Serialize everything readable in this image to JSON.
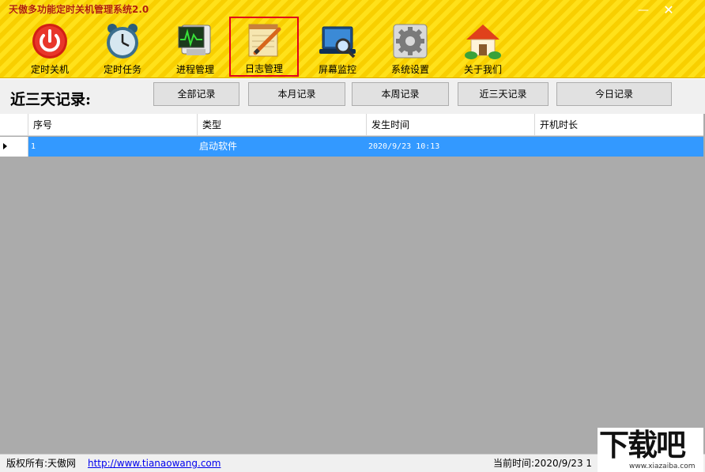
{
  "window": {
    "title": "天傲多功能定时关机管理系统2.0",
    "minimize": "—",
    "close": "✕"
  },
  "toolbar": {
    "items": [
      {
        "label": "定时关机",
        "icon": "power-icon"
      },
      {
        "label": "定时任务",
        "icon": "alarm-clock-icon"
      },
      {
        "label": "进程管理",
        "icon": "monitor-chart-icon"
      },
      {
        "label": "日志管理",
        "icon": "notepad-pen-icon",
        "active": true
      },
      {
        "label": "屏幕监控",
        "icon": "laptop-magnifier-icon"
      },
      {
        "label": "系统设置",
        "icon": "gear-icon"
      },
      {
        "label": "关于我们",
        "icon": "house-icon"
      }
    ]
  },
  "filter": {
    "title": "近三天记录:",
    "buttons": [
      "全部记录",
      "本月记录",
      "本周记录",
      "近三天记录",
      "今日记录"
    ]
  },
  "grid": {
    "columns": [
      "序号",
      "类型",
      "发生时间",
      "开机时长"
    ],
    "rows": [
      {
        "index": "1",
        "type": "启动软件",
        "time": "2020/9/23 10:13",
        "duration": ""
      }
    ]
  },
  "status": {
    "copyright": "版权所有:天傲网",
    "link": "http://www.tianaowang.com",
    "clock": "当前时间:2020/9/23 1"
  },
  "watermark": {
    "big": "下载吧",
    "small": "www.xiazaiba.com"
  },
  "colors": {
    "toolbar_yellow": "#ffe11a",
    "title_red": "#b22000",
    "active_border": "#e0001b",
    "selection_blue": "#3399ff",
    "grid_background": "#ababab"
  }
}
